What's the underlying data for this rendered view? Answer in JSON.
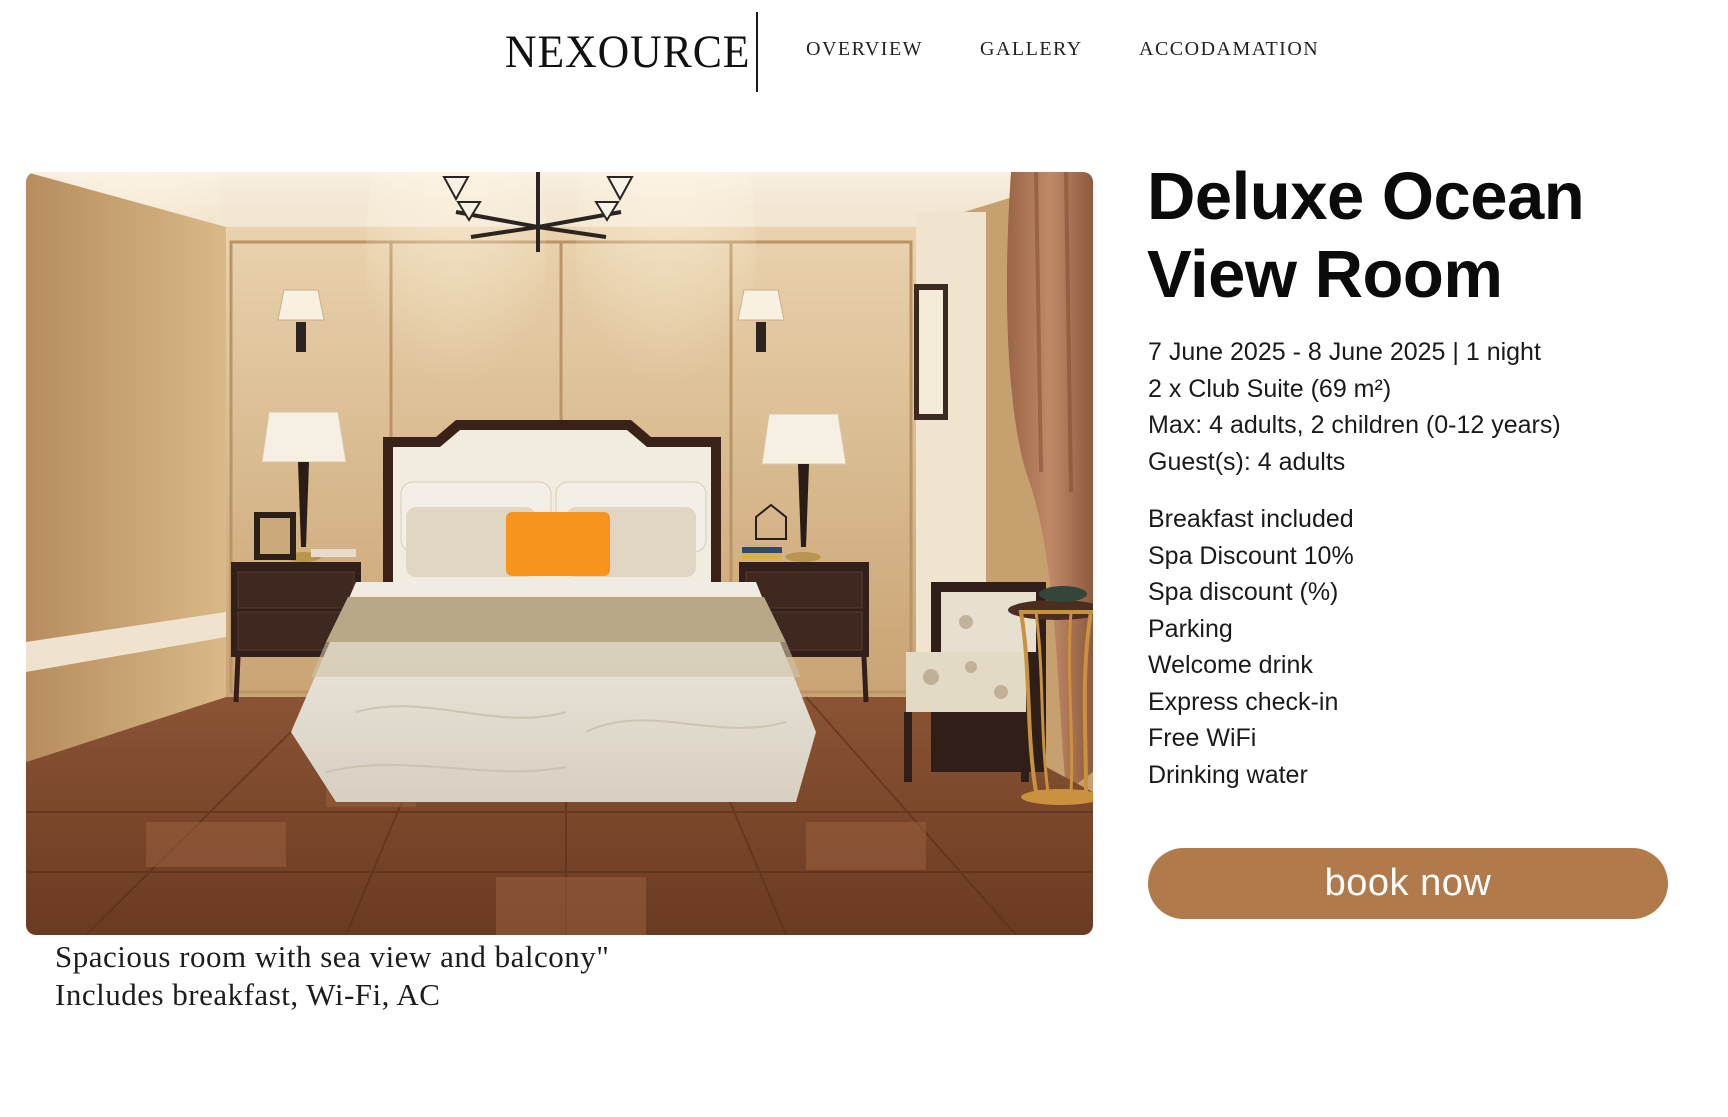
{
  "header": {
    "brand": "NEXOURCE",
    "nav": [
      {
        "label": "OVERVIEW"
      },
      {
        "label": "GALLERY"
      },
      {
        "label": "ACCODAMATION"
      }
    ]
  },
  "room": {
    "title": "Deluxe Ocean View Room",
    "info": [
      "7 June 2025 - 8 June 2025 | 1 night",
      "2 x Club Suite (69 m²)",
      "Max: 4 adults, 2 children (0-12 years)",
      "Guest(s): 4 adults"
    ],
    "amenities": [
      "Breakfast included",
      "Spa Discount 10%",
      "Spa discount (%)",
      "Parking",
      "Welcome drink",
      "Express check-in",
      "Free WiFi",
      "Drinking water"
    ],
    "caption_lines": [
      "Spacious room with sea view and balcony\"",
      "Includes breakfast, Wi-Fi, AC"
    ],
    "book_label": "book now"
  },
  "colors": {
    "accent": "#b07a4b",
    "wall": "#d8b98e",
    "floor": "#7a4428",
    "pillow_accent": "#f7941d"
  }
}
